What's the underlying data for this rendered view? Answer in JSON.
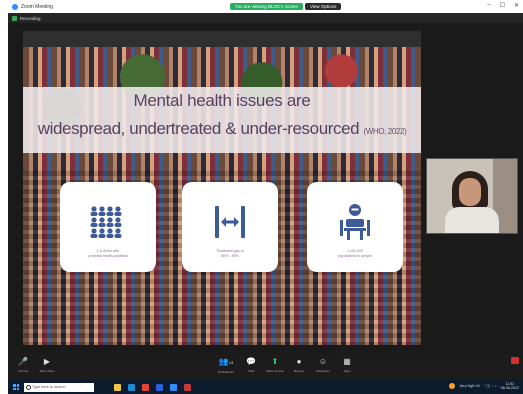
{
  "window": {
    "title": "Zoom Meeting",
    "share_banner": "You are viewing BLOC's screen",
    "view_options": "View Options",
    "controls": [
      "–",
      "☐",
      "✕"
    ]
  },
  "subbar": {
    "label": "Recording"
  },
  "slide": {
    "title_line1": "Mental health issues are",
    "title_line2": "widespread, undertreated & under-resourced",
    "citation": "(WHO, 2022)",
    "cards": [
      {
        "icon": "people-grid-icon",
        "caption_line1": "1 in 8 live with",
        "caption_line2": "a mental health condition"
      },
      {
        "icon": "treatment-gap-icon",
        "caption_line1": "Treatment gap of",
        "caption_line2": "80% - 90%"
      },
      {
        "icon": "psychiatrist-icon",
        "caption_line1": "1:100,000",
        "caption_line2": "psychiatrist to people"
      }
    ]
  },
  "toolbar": {
    "items": [
      {
        "icon": "microphone-icon",
        "label": "Unmute"
      },
      {
        "icon": "video-icon",
        "label": "Start Video"
      },
      {
        "icon": "participants-icon",
        "label": "Participants"
      },
      {
        "icon": "chat-icon",
        "label": "Chat"
      },
      {
        "icon": "share-screen-icon",
        "label": "Share Screen"
      },
      {
        "icon": "record-icon",
        "label": "Record"
      },
      {
        "icon": "reactions-icon",
        "label": "Reactions"
      },
      {
        "icon": "apps-icon",
        "label": "Apps"
      }
    ],
    "participant_count": "13"
  },
  "taskbar": {
    "search_placeholder": "Type here to search",
    "weather": "Very high UV",
    "time": "11:52",
    "date": "08-06-2022"
  },
  "colors": {
    "title_text": "#5a4060",
    "share_green": "#27ae60",
    "taskbar": "#0d1b2e"
  }
}
